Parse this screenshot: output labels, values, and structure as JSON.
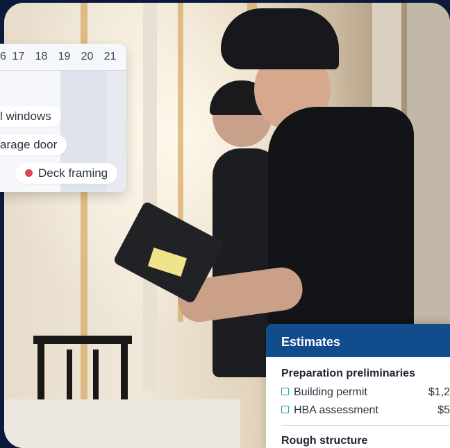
{
  "schedule": {
    "days": [
      "6",
      "17",
      "18",
      "19",
      "20",
      "21"
    ],
    "tasks": [
      {
        "label": "l windows"
      },
      {
        "label": "arage door"
      },
      {
        "label": "Deck framing",
        "status_color": "#e0434e"
      }
    ]
  },
  "estimates": {
    "title": "Estimates",
    "sections": [
      {
        "title": "Preparation preliminaries",
        "items": [
          {
            "label": "Building permit",
            "amount": "$1,2"
          },
          {
            "label": "HBA assessment",
            "amount": "$5"
          }
        ]
      },
      {
        "title": "Rough structure",
        "items": []
      }
    ]
  },
  "colors": {
    "estimates_header": "#114d8c",
    "checkbox": "#1aa4a8",
    "status_dot": "#e0434e",
    "background": "#0b1a3a"
  }
}
